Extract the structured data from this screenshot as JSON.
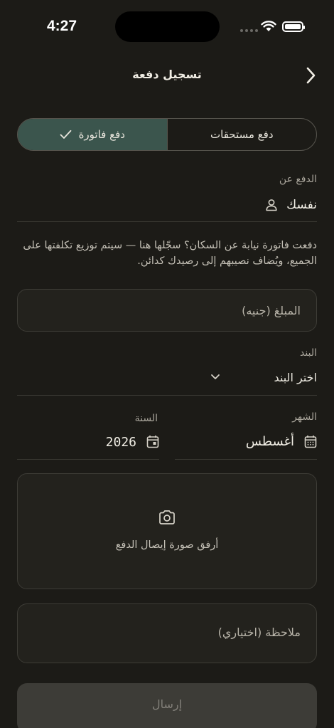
{
  "status_bar": {
    "time": "4:27"
  },
  "header": {
    "title": "تسجيل دفعة"
  },
  "segmented": {
    "options": [
      {
        "label": "دفع مستحقات",
        "selected": false
      },
      {
        "label": "دفع فاتورة",
        "selected": true
      }
    ]
  },
  "payer": {
    "label": "الدفع عن",
    "value": "نفسك"
  },
  "help_text": "دفعت فاتورة نيابة عن السكان؟ سجّلها هنا — سيتم توزيع تكلفتها على الجميع، ويُضاف نصيبهم إلى رصيدك كدائن.",
  "amount": {
    "placeholder": "المبلغ (جنيه)"
  },
  "category": {
    "label": "البند",
    "value": "اختر البند"
  },
  "month": {
    "label": "الشهر",
    "value": "أغسطس"
  },
  "year": {
    "label": "السنة",
    "value": "2026"
  },
  "receipt": {
    "label": "أرفق صورة إيصال الدفع"
  },
  "note": {
    "placeholder": "ملاحظة (اختياري)"
  },
  "submit": {
    "label": "إرسال"
  },
  "colors": {
    "accent": "#3b554d",
    "background": "#1c1b17",
    "card": "#23221d"
  },
  "icons": [
    "chevron-right-icon",
    "check-icon",
    "person-icon",
    "chevron-down-icon",
    "calendar-icon",
    "camera-icon"
  ]
}
